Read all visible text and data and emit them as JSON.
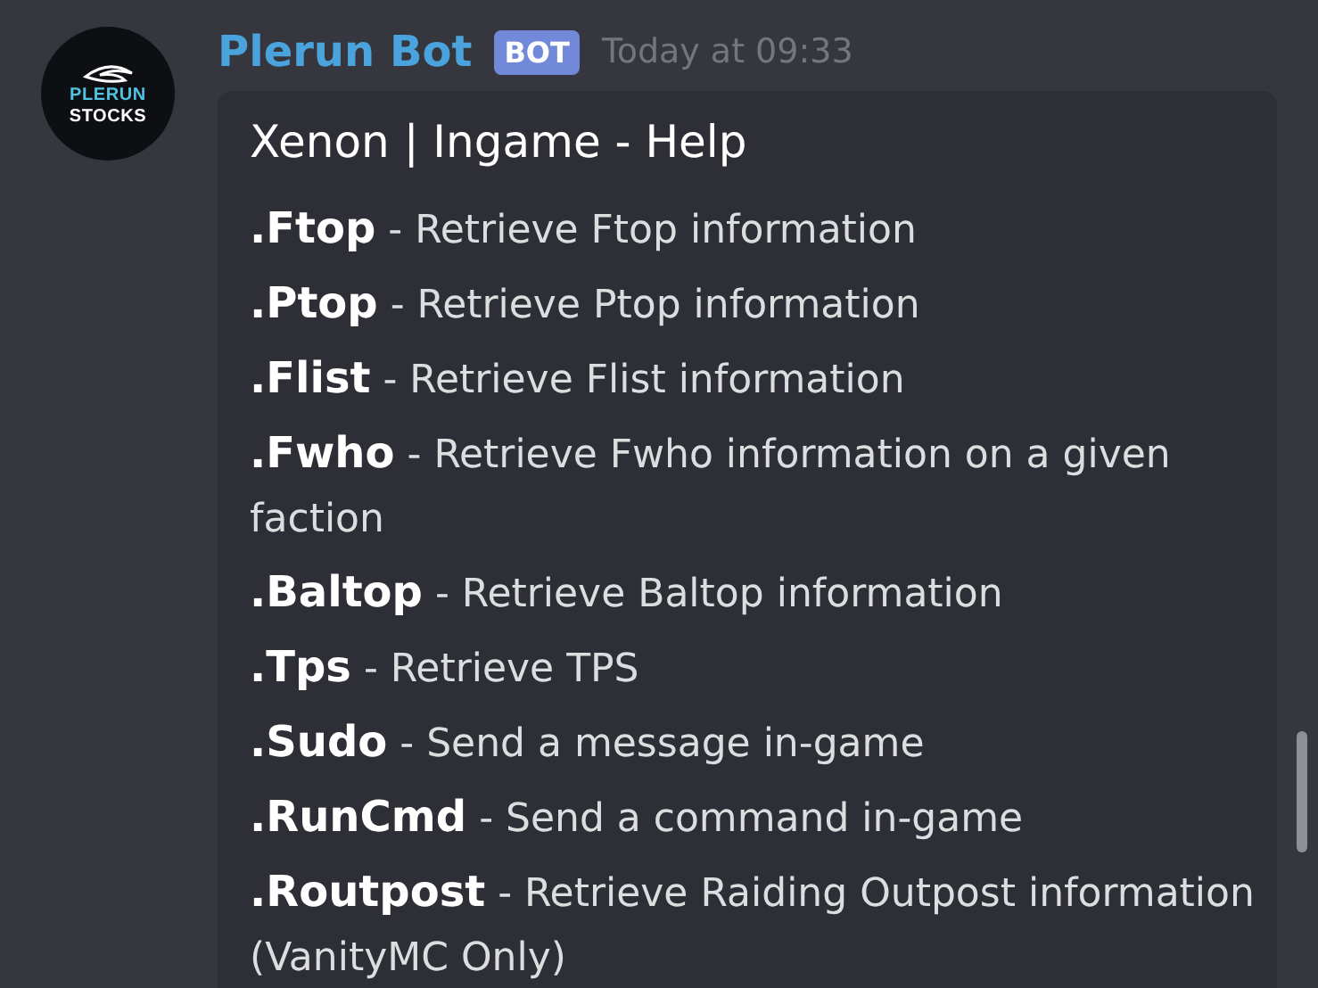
{
  "message": {
    "avatar_text": [
      "PLERUN",
      "STOCKS"
    ],
    "author": "Plerun Bot",
    "badge": "BOT",
    "timestamp": "Today at 09:33",
    "embed": {
      "title": "Xenon | Ingame - Help",
      "lines": [
        "**.Ftop** - Retrieve Ftop information",
        "**.Ptop** - Retrieve Ptop information",
        "**.Flist** - Retrieve Flist information",
        "**.Fwho** - Retrieve Fwho information on a given faction",
        "**.Baltop** - Retrieve Baltop information",
        "**.Tps** - Retrieve TPS",
        "**.Sudo** - Send a message in-game",
        "**.RunCmd** - Send a command in-game",
        "**.Routpost** - Retrieve Raiding Outpost information (VanityMC Only)"
      ]
    }
  }
}
